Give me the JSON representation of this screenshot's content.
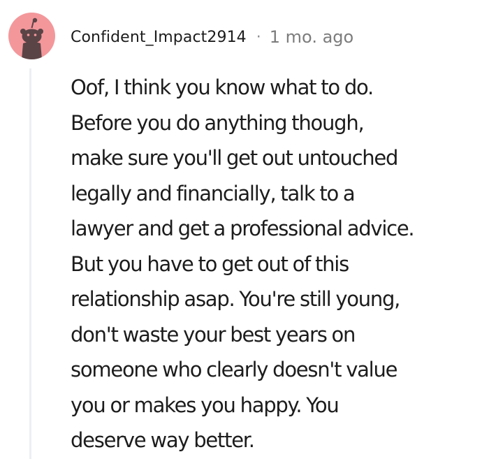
{
  "comment": {
    "author": "Confident_Impact2914",
    "separator": "·",
    "timestamp": "1 mo. ago",
    "avatar_icon": "reddit-snoo-icon",
    "avatar_color": "#f3979b",
    "body_lines": [
      "Oof, I think you know what to do.",
      "Before you do anything though,",
      "make sure you'll get out untouched",
      "legally and financially, talk to a",
      "lawyer and get a professional advice.",
      "But you have to get out of this",
      "relationship asap. You're still young,",
      "don't waste your best years on",
      "someone who clearly doesn't value",
      "you or makes you happy. You",
      "deserve way better."
    ]
  }
}
